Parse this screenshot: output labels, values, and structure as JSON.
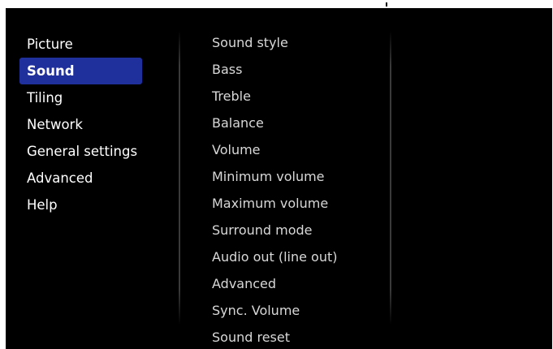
{
  "left_menu": {
    "items": [
      {
        "label": "Picture",
        "selected": false
      },
      {
        "label": "Sound",
        "selected": true
      },
      {
        "label": "Tiling",
        "selected": false
      },
      {
        "label": "Network",
        "selected": false
      },
      {
        "label": "General settings",
        "selected": false
      },
      {
        "label": "Advanced",
        "selected": false
      },
      {
        "label": "Help",
        "selected": false
      }
    ]
  },
  "right_menu": {
    "items": [
      {
        "label": "Sound style"
      },
      {
        "label": "Bass"
      },
      {
        "label": "Treble"
      },
      {
        "label": "Balance"
      },
      {
        "label": "Volume"
      },
      {
        "label": "Minimum volume"
      },
      {
        "label": "Maximum volume"
      },
      {
        "label": "Surround mode"
      },
      {
        "label": "Audio out (line out)"
      },
      {
        "label": "Advanced"
      },
      {
        "label": "Sync. Volume"
      },
      {
        "label": "Sound reset"
      }
    ]
  },
  "colors": {
    "background": "#000000",
    "selected_highlight": "#1f2f9c",
    "primary_text": "#ffffff",
    "secondary_text": "#d8d8d8"
  }
}
